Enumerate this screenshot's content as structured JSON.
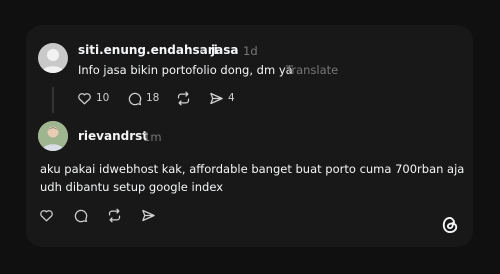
{
  "comment1": {
    "username": "siti.enung.endahsari",
    "reply_to": "jasa",
    "time": "1d",
    "text": "Info jasa bikin portofolio dong, dm ya",
    "translate": "Translate",
    "likes": "10",
    "replies": "18",
    "shares": "4"
  },
  "comment2": {
    "username": "rievandrst",
    "time": "1m",
    "text_line1": "aku pakai idwebhost kak, affordable banget buat porto cuma 700rban aja",
    "text_line2": "udh dibantu setup google index"
  },
  "icons": [
    "heart-icon",
    "comment-icon",
    "repost-icon",
    "share-icon",
    "threads-logo-icon"
  ]
}
